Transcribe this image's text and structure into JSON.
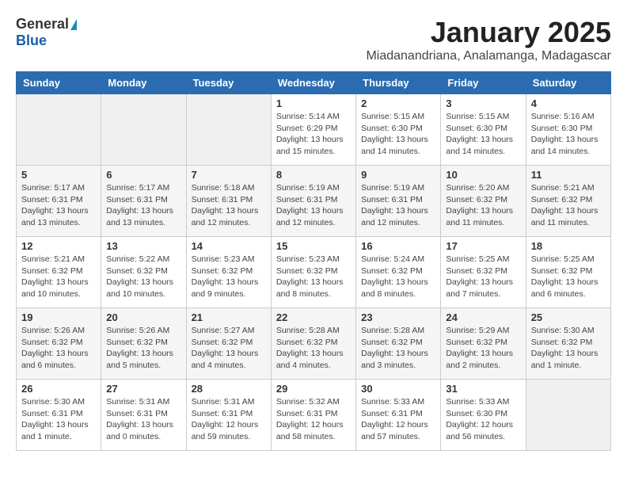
{
  "header": {
    "logo_general": "General",
    "logo_blue": "Blue",
    "month_title": "January 2025",
    "location": "Miadanandriana, Analamanga, Madagascar"
  },
  "days_of_week": [
    "Sunday",
    "Monday",
    "Tuesday",
    "Wednesday",
    "Thursday",
    "Friday",
    "Saturday"
  ],
  "weeks": [
    [
      {
        "day": "",
        "info": ""
      },
      {
        "day": "",
        "info": ""
      },
      {
        "day": "",
        "info": ""
      },
      {
        "day": "1",
        "info": "Sunrise: 5:14 AM\nSunset: 6:29 PM\nDaylight: 13 hours\nand 15 minutes."
      },
      {
        "day": "2",
        "info": "Sunrise: 5:15 AM\nSunset: 6:30 PM\nDaylight: 13 hours\nand 14 minutes."
      },
      {
        "day": "3",
        "info": "Sunrise: 5:15 AM\nSunset: 6:30 PM\nDaylight: 13 hours\nand 14 minutes."
      },
      {
        "day": "4",
        "info": "Sunrise: 5:16 AM\nSunset: 6:30 PM\nDaylight: 13 hours\nand 14 minutes."
      }
    ],
    [
      {
        "day": "5",
        "info": "Sunrise: 5:17 AM\nSunset: 6:31 PM\nDaylight: 13 hours\nand 13 minutes."
      },
      {
        "day": "6",
        "info": "Sunrise: 5:17 AM\nSunset: 6:31 PM\nDaylight: 13 hours\nand 13 minutes."
      },
      {
        "day": "7",
        "info": "Sunrise: 5:18 AM\nSunset: 6:31 PM\nDaylight: 13 hours\nand 12 minutes."
      },
      {
        "day": "8",
        "info": "Sunrise: 5:19 AM\nSunset: 6:31 PM\nDaylight: 13 hours\nand 12 minutes."
      },
      {
        "day": "9",
        "info": "Sunrise: 5:19 AM\nSunset: 6:31 PM\nDaylight: 13 hours\nand 12 minutes."
      },
      {
        "day": "10",
        "info": "Sunrise: 5:20 AM\nSunset: 6:32 PM\nDaylight: 13 hours\nand 11 minutes."
      },
      {
        "day": "11",
        "info": "Sunrise: 5:21 AM\nSunset: 6:32 PM\nDaylight: 13 hours\nand 11 minutes."
      }
    ],
    [
      {
        "day": "12",
        "info": "Sunrise: 5:21 AM\nSunset: 6:32 PM\nDaylight: 13 hours\nand 10 minutes."
      },
      {
        "day": "13",
        "info": "Sunrise: 5:22 AM\nSunset: 6:32 PM\nDaylight: 13 hours\nand 10 minutes."
      },
      {
        "day": "14",
        "info": "Sunrise: 5:23 AM\nSunset: 6:32 PM\nDaylight: 13 hours\nand 9 minutes."
      },
      {
        "day": "15",
        "info": "Sunrise: 5:23 AM\nSunset: 6:32 PM\nDaylight: 13 hours\nand 8 minutes."
      },
      {
        "day": "16",
        "info": "Sunrise: 5:24 AM\nSunset: 6:32 PM\nDaylight: 13 hours\nand 8 minutes."
      },
      {
        "day": "17",
        "info": "Sunrise: 5:25 AM\nSunset: 6:32 PM\nDaylight: 13 hours\nand 7 minutes."
      },
      {
        "day": "18",
        "info": "Sunrise: 5:25 AM\nSunset: 6:32 PM\nDaylight: 13 hours\nand 6 minutes."
      }
    ],
    [
      {
        "day": "19",
        "info": "Sunrise: 5:26 AM\nSunset: 6:32 PM\nDaylight: 13 hours\nand 6 minutes."
      },
      {
        "day": "20",
        "info": "Sunrise: 5:26 AM\nSunset: 6:32 PM\nDaylight: 13 hours\nand 5 minutes."
      },
      {
        "day": "21",
        "info": "Sunrise: 5:27 AM\nSunset: 6:32 PM\nDaylight: 13 hours\nand 4 minutes."
      },
      {
        "day": "22",
        "info": "Sunrise: 5:28 AM\nSunset: 6:32 PM\nDaylight: 13 hours\nand 4 minutes."
      },
      {
        "day": "23",
        "info": "Sunrise: 5:28 AM\nSunset: 6:32 PM\nDaylight: 13 hours\nand 3 minutes."
      },
      {
        "day": "24",
        "info": "Sunrise: 5:29 AM\nSunset: 6:32 PM\nDaylight: 13 hours\nand 2 minutes."
      },
      {
        "day": "25",
        "info": "Sunrise: 5:30 AM\nSunset: 6:32 PM\nDaylight: 13 hours\nand 1 minute."
      }
    ],
    [
      {
        "day": "26",
        "info": "Sunrise: 5:30 AM\nSunset: 6:31 PM\nDaylight: 13 hours\nand 1 minute."
      },
      {
        "day": "27",
        "info": "Sunrise: 5:31 AM\nSunset: 6:31 PM\nDaylight: 13 hours\nand 0 minutes."
      },
      {
        "day": "28",
        "info": "Sunrise: 5:31 AM\nSunset: 6:31 PM\nDaylight: 12 hours\nand 59 minutes."
      },
      {
        "day": "29",
        "info": "Sunrise: 5:32 AM\nSunset: 6:31 PM\nDaylight: 12 hours\nand 58 minutes."
      },
      {
        "day": "30",
        "info": "Sunrise: 5:33 AM\nSunset: 6:31 PM\nDaylight: 12 hours\nand 57 minutes."
      },
      {
        "day": "31",
        "info": "Sunrise: 5:33 AM\nSunset: 6:30 PM\nDaylight: 12 hours\nand 56 minutes."
      },
      {
        "day": "",
        "info": ""
      }
    ]
  ]
}
